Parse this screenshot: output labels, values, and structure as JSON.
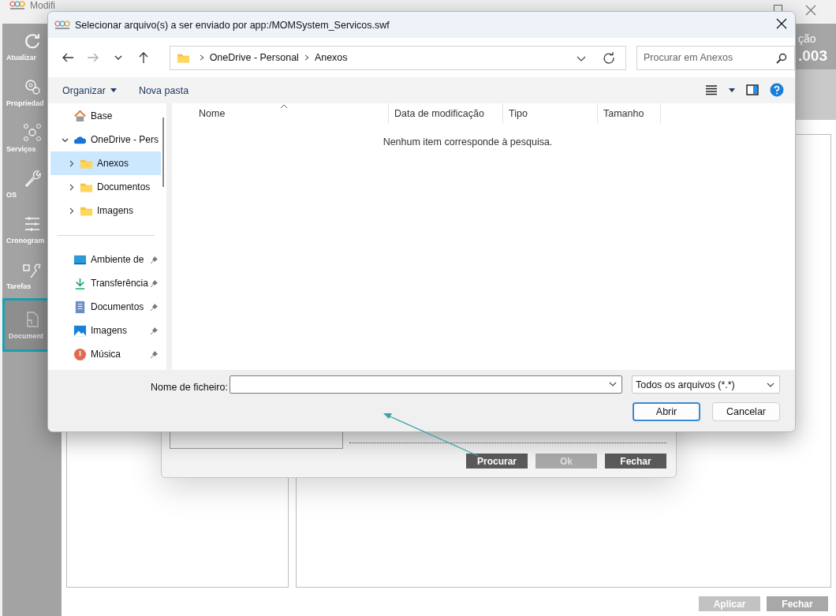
{
  "app": {
    "title": "Modifi",
    "header_fragments": [
      "ção",
      ".003"
    ],
    "sidebar": [
      {
        "label": "Atualizar",
        "kind": "refresh",
        "selected": false,
        "disabled": false
      },
      {
        "label": "Propriedad",
        "kind": "gear",
        "selected": false,
        "disabled": false
      },
      {
        "label": "Serviços",
        "kind": "nodes",
        "selected": false,
        "disabled": false
      },
      {
        "label": "OS",
        "kind": "wrench",
        "selected": false,
        "disabled": false
      },
      {
        "label": "Cronogram",
        "kind": "sliders",
        "selected": false,
        "disabled": false
      },
      {
        "label": "Tarefas",
        "kind": "task",
        "selected": false,
        "disabled": false
      },
      {
        "label": "Document",
        "kind": "document",
        "selected": true,
        "disabled": true
      }
    ],
    "inner_dialog": {
      "buttons": [
        {
          "label": "Procurar",
          "disabled": false
        },
        {
          "label": "Ok",
          "disabled": true
        },
        {
          "label": "Fechar",
          "disabled": false
        }
      ]
    },
    "footer_buttons": [
      {
        "label": "Aplicar",
        "disabled": true
      },
      {
        "label": "Fechar",
        "disabled": false
      }
    ]
  },
  "file_dialog": {
    "title": "Selecionar arquivo(s) a ser enviado por app:/MOMSystem_Servicos.swf",
    "nav_buttons": [
      {
        "kind": "back",
        "disabled": false
      },
      {
        "kind": "forward",
        "disabled": true
      },
      {
        "kind": "recent",
        "disabled": false
      },
      {
        "kind": "up",
        "disabled": false
      }
    ],
    "breadcrumb": [
      "OneDrive - Personal",
      "Anexos"
    ],
    "search": {
      "placeholder": "Procurar em Anexos"
    },
    "commands": [
      {
        "label": "Organizar",
        "menu": true
      },
      {
        "label": "Nova pasta",
        "menu": false
      }
    ],
    "nav": [
      {
        "label": "Base",
        "kind": "home",
        "selected": false
      },
      {
        "label": "OneDrive - Pers",
        "kind": "cloud",
        "selected": false,
        "expanded": true,
        "children": [
          {
            "label": "Anexos",
            "kind": "folder",
            "selected": true,
            "expanded": false
          },
          {
            "label": "Documentos",
            "kind": "folder",
            "selected": false,
            "expanded": false
          },
          {
            "label": "Imagens",
            "kind": "folder",
            "selected": false,
            "expanded": false
          }
        ]
      }
    ],
    "quick_access": [
      {
        "label": "Ambiente de",
        "kind": "desktop",
        "pinned": true
      },
      {
        "label": "Transferência",
        "kind": "download",
        "pinned": true
      },
      {
        "label": "Documentos",
        "kind": "document",
        "pinned": true
      },
      {
        "label": "Imagens",
        "kind": "pictures",
        "pinned": true
      },
      {
        "label": "Música",
        "kind": "music",
        "pinned": true
      }
    ],
    "columns": [
      {
        "label": "Nome",
        "sorted": true
      },
      {
        "label": "Data de modificação",
        "sorted": false
      },
      {
        "label": "Tipo",
        "sorted": false
      },
      {
        "label": "Tamanho",
        "sorted": false
      }
    ],
    "empty_message": "Nenhum item corresponde à pesquisa.",
    "file_name_label": "Nome de ficheiro:",
    "file_type": "Todos os arquivos (*.*)",
    "buttons": [
      {
        "label": "Abrir",
        "default": true
      },
      {
        "label": "Cancelar",
        "default": false
      }
    ]
  }
}
